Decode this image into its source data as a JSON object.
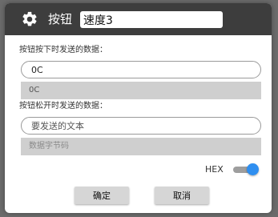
{
  "header": {
    "title": "按钮",
    "name_value": "速度3",
    "icon": "gear-icon"
  },
  "press": {
    "label": "按钮按下时发送的数据：",
    "text_value": "0C",
    "bytes_value": "0C"
  },
  "release": {
    "label": "按钮松开时发送的数据：",
    "text_placeholder": "要发送的文本",
    "bytes_placeholder": "数据字节码"
  },
  "hex": {
    "label": "HEX",
    "enabled": true
  },
  "actions": {
    "confirm_label": "确定",
    "cancel_label": "取消"
  },
  "colors": {
    "header_bg": "#3d3d3d",
    "toggle_on": "#2f8ff0"
  }
}
